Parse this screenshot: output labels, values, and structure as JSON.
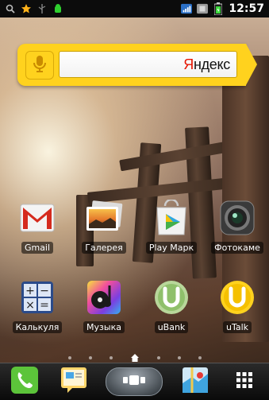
{
  "status_bar": {
    "time": "12:57",
    "icons_left": [
      "search-icon",
      "star-icon",
      "usb-icon",
      "android-debug-icon"
    ],
    "icons_right": [
      "signal-icon",
      "sim-icon",
      "battery-icon"
    ]
  },
  "search_widget": {
    "logo_first_letter": "Я",
    "logo_rest": "ндекс",
    "mic_icon": "microphone-icon",
    "accent": "#ffd21e"
  },
  "apps": [
    {
      "label": "Gmail",
      "icon": "gmail-icon"
    },
    {
      "label": "Галерея",
      "icon": "gallery-icon"
    },
    {
      "label": "Play Марк",
      "icon": "play-market-icon"
    },
    {
      "label": "Фотокаме",
      "icon": "camera-icon"
    },
    {
      "label": "Калькуля",
      "icon": "calculator-icon"
    },
    {
      "label": "Музыка",
      "icon": "music-icon"
    },
    {
      "label": "uBank",
      "icon": "ubank-icon"
    },
    {
      "label": "uTalk",
      "icon": "utalk-icon"
    }
  ],
  "pager": {
    "pages": 7,
    "current": 4
  },
  "dock": [
    "phone-icon",
    "messages-icon",
    "app-drawer-icon",
    "maps-icon",
    "grid-menu-icon"
  ]
}
